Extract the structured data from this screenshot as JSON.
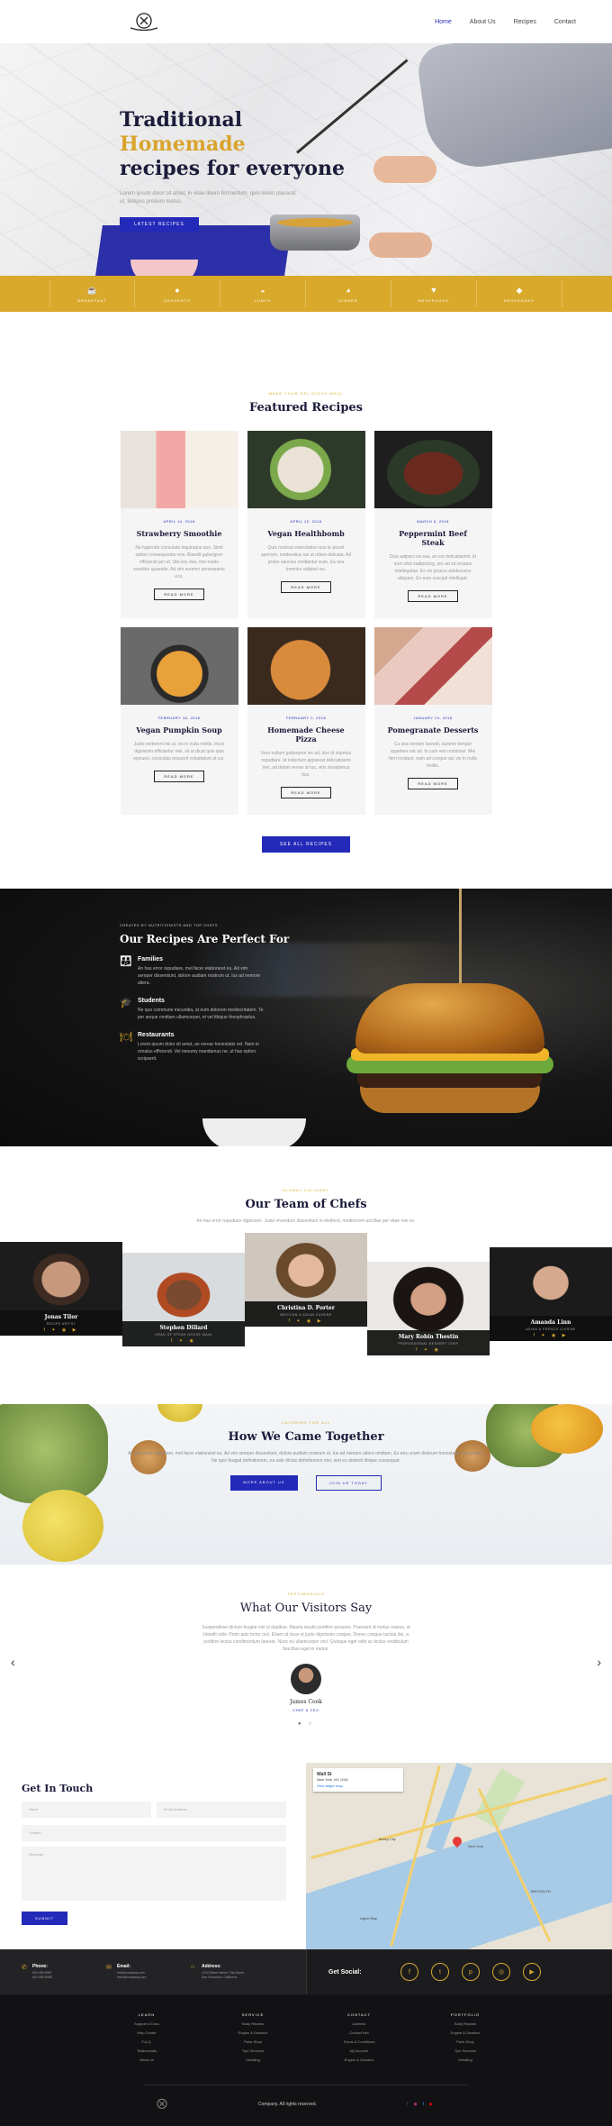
{
  "nav": {
    "items": [
      "Home",
      "About Us",
      "Recipes",
      "Contact"
    ]
  },
  "hero": {
    "title_part1": "Traditional",
    "title_highlight": "Homemade",
    "title_part2": "recipes for everyone",
    "text": "Lorem ipsum dolor sit amet, in vitae libero fermentum, quis lorem placerat ut, tempus pretium metus.",
    "button": "LATEST RECIPES"
  },
  "categories": [
    {
      "icon": "☕",
      "label": "BREAKFAST"
    },
    {
      "icon": "●",
      "label": "DESSERTS"
    },
    {
      "icon": "◒",
      "label": "LUNCH"
    },
    {
      "icon": "◕",
      "label": "DINNER"
    },
    {
      "icon": "▼",
      "label": "BEVERAGES"
    },
    {
      "icon": "◆",
      "label": "BEVERAGES"
    }
  ],
  "featured": {
    "subtitle": "MAKE YOUR DELICIOUS MEAL",
    "title": "Featured Recipes",
    "button": "SEE ALL RECIPES",
    "read_more": "READ MORE",
    "recipes": [
      {
        "date": "APRIL 14, 2018",
        "title": "Strawberry Smoothie",
        "text": "Ne fugiendo consulatu inquinatus quo. Simil option consequuntur eos. Blandit gubergren efficiendi per ut. Ubi eos deo, mei modo evertitur quaestio. Ad vim summo persequeris eos."
      },
      {
        "date": "APRIL 12, 2018",
        "title": "Vegan Healthbomb",
        "text": "Quis nostrud exercitation quo te possit aperiam, moderatius ius ut ridere delicata. Ad probo sanctus omittantur eum. Ea sea invenire adipisci eu."
      },
      {
        "date": "MARCH 8, 2018",
        "title": "Peppermint Beef Steak",
        "text": "Duis adipisci ea sea, an est delicatissimi. Id eum dicit sadipscing, pro ad sit ornatus intellegebat. Ex vix graeco adolescens aliquam. Ex eum suscipit intellegat."
      },
      {
        "date": "FEBRUARY 16, 2018",
        "title": "Vegan Pumpkin Soup",
        "text": "Justo verterem his ut, vix in nulla mollis. Iriure dignissim efficiantur mei, sit ut dicat quis quis epicurei, consulatu posuerit voluptatum at ius."
      },
      {
        "date": "FEBRUARY 2, 2018",
        "title": "Homemade Cheese Pizza",
        "text": "Vero nullam gubergren vix ad, duo id impetus repudiare. Id indoctum appareat delicatissimi mei, ad debet verear at ius, viris mandamus duo."
      },
      {
        "date": "JANUARY 24, 2018",
        "title": "Pomegranate Desserts",
        "text": "Cu sea veniam laoreet, summo tempor appetere est ad. In cum veri nominavi. Mei ferri invidunt, eam ad congue ad, vix in nulla mollis."
      }
    ]
  },
  "perfect": {
    "subtitle": "CREATED BY NUTRITIONISTS AND TOP CHEFS",
    "title": "Our Recipes Are Perfect For",
    "items": [
      {
        "icon": "👪",
        "title": "Families",
        "text": "An has error repudiare, mel facer elaboraret eu. Ad vim semper dissentiunt, dolore audiam nostrum ut. Ius ad nemore altera."
      },
      {
        "icon": "🎓",
        "title": "Students",
        "text": "Ne quo commune iracundia, at eum dolorem mediocritatem. Te per aeque omittam ullamcorper, et vel tibique theophrastus."
      },
      {
        "icon": "🍽",
        "title": "Restaurants",
        "text": "Lorem ipsum dolor sit amet, an verear honestatis vel. Nam in ornatus efficiendi. Vel nonumy mandamus ne, ut has option scripserit."
      }
    ]
  },
  "chefs": {
    "subtitle": "GLOBAL CULINARY",
    "title": "Our Team of Chefs",
    "desc": "An has error repudiare dignissim. Justo vivendum dissentiunt in eleifend, mediocrem ancillae per vitae mei ex.",
    "members": [
      {
        "name": "Jonas Tilor",
        "role": "RECIPE ARTIST",
        "social": "f ✦ ◉ ▶"
      },
      {
        "name": "Stephen Dillard",
        "role": "HEAD OF STEAK HOUSE MAIN",
        "social": "f ✦ ◉"
      },
      {
        "name": "Christina D. Porter",
        "role": "MEXICAN & ASIAN CUISINE",
        "social": "f ✦ ◉ ▶"
      },
      {
        "name": "Mary Robin Thestin",
        "role": "PROFESSIONAL DESSERT CHEF",
        "social": "f ✦ ◉"
      },
      {
        "name": "Amanda Linn",
        "role": "ASIAN & FRENCH CUISINE",
        "social": "f ✦ ◉ ▶"
      }
    ]
  },
  "together": {
    "subtitle": "CATERING FOR ALL",
    "title": "How We Came Together",
    "text": "An has error repudiare, mel facer elaboraret eu. Ad vim semper dissentiunt, dolore audiam nostrum ut. Ius ad nemore altera omittam. Ex eos unum dolorum honestatis, has putent. Ne quis feugiat definitionem, ea sale dictas definitionem mei, sed eu deleniti tibique consequat.",
    "btn1": "MORE ABOUT US",
    "btn2": "JOIN US TODAY"
  },
  "visitors": {
    "subtitle": "TESTIMONIALS",
    "title": "What Our Visitors Say",
    "text": "Suspendisse dictum feugiat nisl ut dapibus. Mauris iaculis porttitor posuere. Praesent id metus massa, ut blandit odio. Proin quis tortor orci. Etiam at risus et justo dignissim congue. Donec congue lacinia dui, a porttitor lectus condimentum laoreet. Nunc eu ullamcorper orci. Quisque eget odio ac lectus vestibulum faucibus eget in metus.",
    "name": "James Cook",
    "role": "CHEF & CEO",
    "prev": "‹",
    "next": "›",
    "dots": "● ○"
  },
  "contact": {
    "title": "Get In Touch",
    "fields": {
      "name": "Name",
      "email": "Email Address",
      "subject": "Subject",
      "message": "Message"
    },
    "submit": "SUBMIT",
    "map": {
      "place": "Wall St",
      "addr": "New York, NY, USA",
      "link": "View larger map",
      "labels": [
        "Jersey City",
        "New York",
        "BROOKLYN",
        "Upper Bay"
      ]
    }
  },
  "info": {
    "phone": {
      "label": "Phone:",
      "value": "800-989-8987\n800-989-8988"
    },
    "email": {
      "label": "Email:",
      "value": "info@company.com\nhello@company.com"
    },
    "address": {
      "label": "Address:",
      "value": "1234 Street Name, City Name,\nSan Francisco, California"
    },
    "social_label": "Get Social:",
    "social_icons": [
      "f",
      "t",
      "p",
      "◎",
      "▶"
    ]
  },
  "footer": {
    "cols": [
      {
        "head": "LEARN",
        "items": [
          "Support & Docs",
          "Help Center",
          "F.A.Q.",
          "Testimonials",
          "About us"
        ]
      },
      {
        "head": "SERVICE",
        "items": [
          "Body Repairs",
          "Engine & Gearbox",
          "Parts Shop",
          "Tyre Services",
          "Detailing"
        ]
      },
      {
        "head": "CONTACT",
        "items": [
          "Address",
          "Contact Info",
          "Terms & Conditions",
          "My Account",
          "Engine & Gearbox"
        ]
      },
      {
        "head": "PORTFOLIO",
        "items": [
          "Body Repairs",
          "Engine & Gearbox",
          "Parts Shop",
          "Tyre Services",
          "Detailing"
        ]
      }
    ],
    "copyright": "Company. All rights reserved.",
    "social": [
      "f",
      "◉",
      "t",
      "▶"
    ]
  }
}
